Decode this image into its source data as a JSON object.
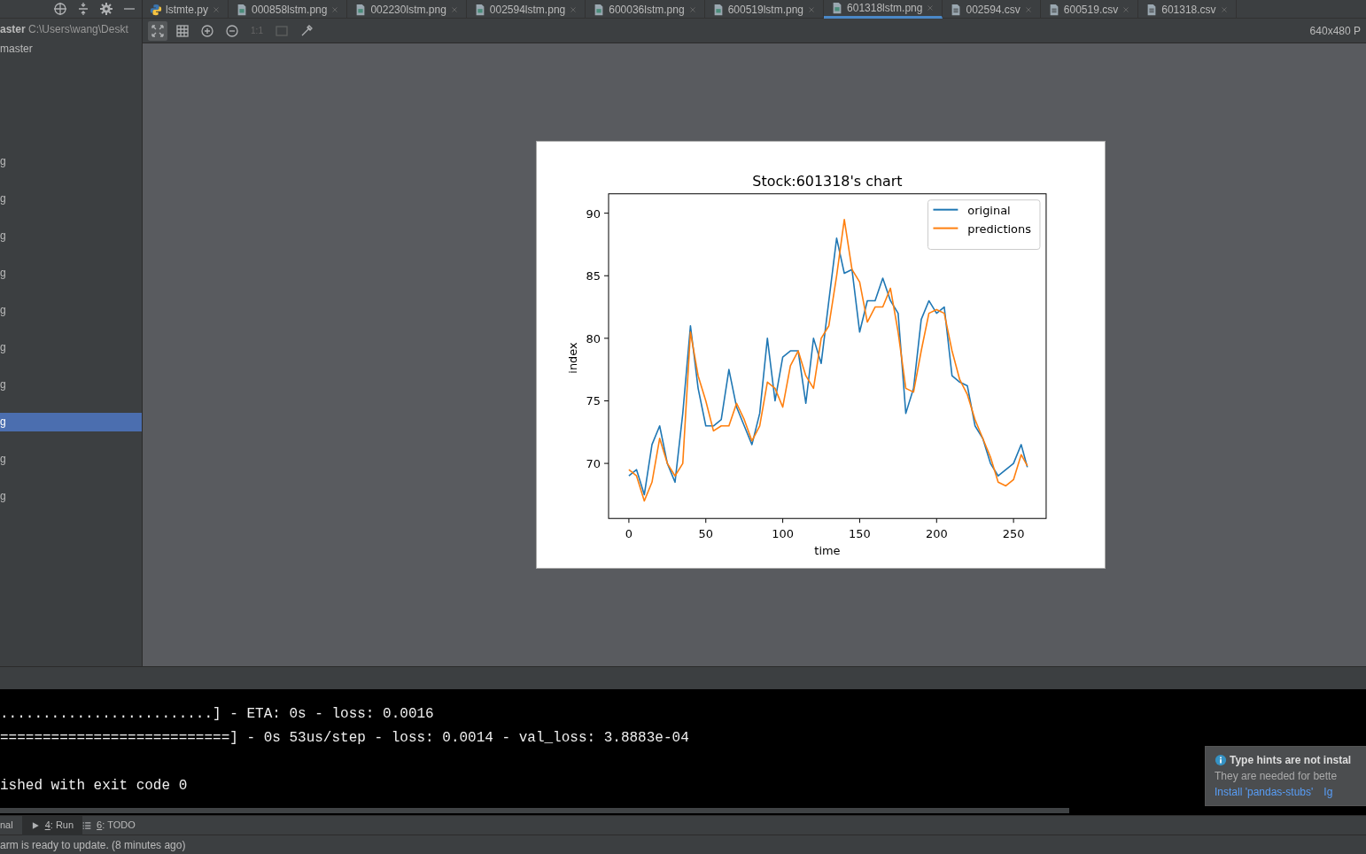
{
  "project_panel": {
    "root_name": "aster",
    "root_path": "C:\\Users\\wang\\Deskt",
    "branch": "master",
    "items": [
      {
        "label": "g",
        "selected": false
      },
      {
        "label": "g",
        "selected": false
      },
      {
        "label": "g",
        "selected": false
      },
      {
        "label": "g",
        "selected": false
      },
      {
        "label": "g",
        "selected": false
      },
      {
        "label": "g",
        "selected": false
      },
      {
        "label": "g",
        "selected": false
      },
      {
        "label": "g",
        "selected": true
      },
      {
        "label": "g",
        "selected": false
      },
      {
        "label": "g",
        "selected": false
      }
    ]
  },
  "editor_tabs": [
    {
      "label": "lstmte.py",
      "kind": "python",
      "selected": false
    },
    {
      "label": "000858lstm.png",
      "kind": "image",
      "selected": false
    },
    {
      "label": "002230lstm.png",
      "kind": "image",
      "selected": false
    },
    {
      "label": "002594lstm.png",
      "kind": "image",
      "selected": false
    },
    {
      "label": "600036lstm.png",
      "kind": "image",
      "selected": false
    },
    {
      "label": "600519lstm.png",
      "kind": "image",
      "selected": false
    },
    {
      "label": "601318lstm.png",
      "kind": "image",
      "selected": true
    },
    {
      "label": "002594.csv",
      "kind": "csv",
      "selected": false
    },
    {
      "label": "600519.csv",
      "kind": "csv",
      "selected": false
    },
    {
      "label": "601318.csv",
      "kind": "csv",
      "selected": false
    }
  ],
  "image_viewer": {
    "fit_selected": true,
    "actual_size": {
      "label": "1:1",
      "disabled": true
    },
    "size_label": "640x480 P",
    "chart_data": {
      "type": "line",
      "title": "Stock:601318's chart",
      "xlabel": "time",
      "ylabel": "index",
      "x": [
        0,
        5,
        10,
        15,
        20,
        25,
        30,
        35,
        40,
        45,
        50,
        55,
        60,
        65,
        70,
        75,
        80,
        85,
        90,
        95,
        100,
        105,
        110,
        115,
        120,
        125,
        130,
        135,
        140,
        145,
        150,
        155,
        160,
        165,
        170,
        175,
        180,
        185,
        190,
        195,
        200,
        205,
        210,
        215,
        220,
        225,
        230,
        235,
        240,
        245,
        250,
        255,
        259
      ],
      "series": [
        {
          "name": "original",
          "color": "#1f77b4",
          "values": [
            69,
            69.5,
            67.5,
            71.5,
            73,
            70,
            68.5,
            74,
            81,
            76,
            73,
            73,
            73.5,
            77.5,
            74.5,
            73,
            71.5,
            74,
            80,
            75,
            78.5,
            79,
            79,
            74.8,
            80,
            78,
            83,
            88,
            85.2,
            85.5,
            80.5,
            83,
            83,
            84.8,
            83,
            82,
            74,
            76,
            81.5,
            83,
            82,
            82.5,
            77,
            76.5,
            76.2,
            73,
            72,
            70,
            69,
            69.5,
            70,
            71.5,
            69.7
          ]
        },
        {
          "name": "predictions",
          "color": "#ff7f0e",
          "values": [
            69.5,
            69,
            67,
            68.5,
            72,
            70,
            69,
            70,
            80.5,
            77,
            75,
            72.6,
            73,
            73,
            74.8,
            73.5,
            71.8,
            73,
            76.5,
            76,
            74.5,
            77.8,
            79,
            77,
            76,
            80,
            81,
            85,
            89.5,
            85.5,
            84.5,
            81.3,
            82.5,
            82.5,
            84,
            80.5,
            76,
            75.7,
            79,
            82,
            82.3,
            82,
            79,
            76.7,
            75.5,
            73.5,
            72,
            70.5,
            68.5,
            68.2,
            68.7,
            70.7,
            69.8
          ]
        }
      ],
      "legend": "upper right",
      "xlim": [
        -13.2,
        271.2
      ],
      "ylim": [
        65.6,
        91.55
      ],
      "xticks": [
        0,
        50,
        100,
        150,
        200,
        250
      ],
      "yticks": [
        70,
        75,
        80,
        85,
        90
      ]
    }
  },
  "console": {
    "lines": [
      ".........................] - ETA: 0s - loss: 0.0016",
      "===========================] - 0s 53us/step - loss: 0.0014 - val_loss: 3.8883e-04",
      "ished with exit code 0"
    ]
  },
  "notification": {
    "title": "Type hints are not instal",
    "body": "They are needed for bette",
    "actions": [
      "Install 'pandas-stubs'",
      "Ig"
    ]
  },
  "tool_tabs": [
    {
      "kind": "plain",
      "label": "nal",
      "selected": false
    },
    {
      "kind": "run",
      "mnemonic": "4",
      "label": ": Run",
      "selected": true
    },
    {
      "kind": "todo",
      "mnemonic": "6",
      "label": ": TODO",
      "selected": false
    }
  ],
  "status_bar": {
    "text": "arm is ready to update. (8 minutes ago)"
  }
}
